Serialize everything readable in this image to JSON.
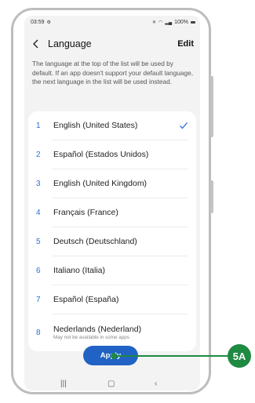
{
  "status_bar": {
    "time": "03:59",
    "battery": "100%"
  },
  "header": {
    "title": "Language",
    "edit_label": "Edit"
  },
  "description": "The language at the top of the list will be used by default. If an app doesn't support your default language, the next language in the list will be used instead.",
  "languages": [
    {
      "number": "1",
      "name": "English (United States)",
      "selected": true
    },
    {
      "number": "2",
      "name": "Español (Estados Unidos)"
    },
    {
      "number": "3",
      "name": "English (United Kingdom)"
    },
    {
      "number": "4",
      "name": "Français (France)"
    },
    {
      "number": "5",
      "name": "Deutsch (Deutschland)"
    },
    {
      "number": "6",
      "name": "Italiano (Italia)"
    },
    {
      "number": "7",
      "name": "Español (España)"
    },
    {
      "number": "8",
      "name": "Nederlands (Nederland)",
      "note": "May not be available in some apps"
    }
  ],
  "apply_label": "Apply",
  "callout_label": "5A",
  "colors": {
    "accent": "#2163c4",
    "callout": "#1e8a42",
    "screen_bg": "#f3f3f3"
  },
  "icons": {
    "back": "chevron-left-icon",
    "check": "check-icon",
    "nav_recent": "recents-icon",
    "nav_home": "home-icon",
    "nav_back": "back-nav-icon"
  }
}
